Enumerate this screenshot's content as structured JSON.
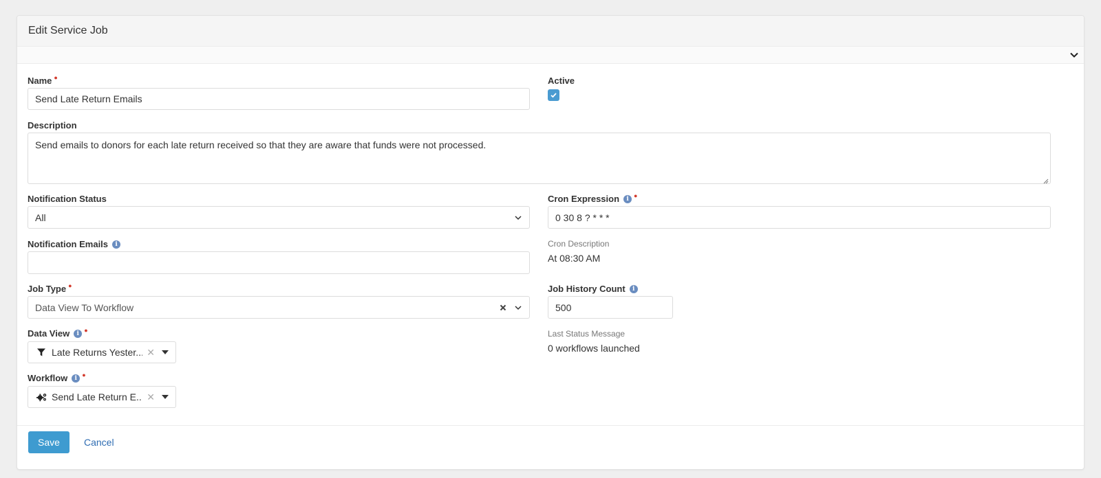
{
  "panel": {
    "title": "Edit Service Job"
  },
  "form": {
    "name": {
      "label": "Name",
      "value": "Send Late Return Emails"
    },
    "active": {
      "label": "Active",
      "checked": true
    },
    "description": {
      "label": "Description",
      "value": "Send emails to donors for each late return received so that they are aware that funds were not processed."
    },
    "notification_status": {
      "label": "Notification Status",
      "value": "All"
    },
    "cron_expression": {
      "label": "Cron Expression",
      "value": "0 30 8 ? * * *"
    },
    "notification_emails": {
      "label": "Notification Emails",
      "value": ""
    },
    "cron_description": {
      "label": "Cron Description",
      "value": "At 08:30 AM"
    },
    "job_type": {
      "label": "Job Type",
      "value": "Data View To Workflow"
    },
    "job_history_count": {
      "label": "Job History Count",
      "value": "500"
    },
    "data_view": {
      "label": "Data View",
      "value": "Late Returns Yester..."
    },
    "last_status_message": {
      "label": "Last Status Message",
      "value": "0 workflows launched"
    },
    "workflow": {
      "label": "Workflow",
      "value": "Send Late Return E..."
    }
  },
  "actions": {
    "save_label": "Save",
    "cancel_label": "Cancel"
  },
  "colors": {
    "accent": "#3e9bd0",
    "required": "#d33a2c",
    "link": "#2f6db3",
    "info": "#6a8dc0"
  }
}
